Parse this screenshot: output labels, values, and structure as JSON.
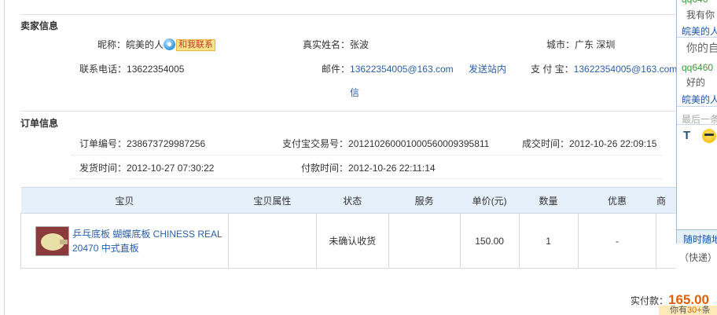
{
  "seller": {
    "section_title": "卖家信息",
    "nickname_label": "昵称：",
    "nickname": "皖美的人",
    "contact_label": "和我联系",
    "realname_label": "真实姓名：",
    "realname": "张波",
    "city_label": "城市：",
    "city": "广东 深圳",
    "phone_label": "联系电话：",
    "phone": "13622354005",
    "email_label": "邮件：",
    "email": "13622354005@163.com",
    "send_msg_line1": "发送站内",
    "send_msg_line2": "信",
    "alipay_label": "支 付 宝：",
    "alipay": "13622354005@163.com"
  },
  "order": {
    "section_title": "订单信息",
    "order_no_label": "订单编号：",
    "order_no": "238673729987256",
    "alipay_trade_label": "支付宝交易号：",
    "alipay_trade_no": "2012102600010005600093958 11",
    "deal_time_label": "成交时间：",
    "deal_time": "2012-10-26 22:09:15",
    "ship_time_label": "发货时间：",
    "ship_time": "2012-10-27 07:30:22",
    "pay_time_label": "付款时间：",
    "pay_time": "2012-10-26 22:11:14"
  },
  "table": {
    "headers": [
      "宝贝",
      "宝贝属性",
      "状态",
      "服务",
      "单价(元)",
      "数量",
      "优惠",
      "商"
    ],
    "rows": [
      {
        "item_title_line1": "乒乓底板 蝴蝶底板 CHINESS REAL",
        "item_title_line2": "20470 中式直板",
        "attributes": "",
        "status": "未确认收货",
        "service": "",
        "price": "150.00",
        "qty": "1",
        "discount": "-",
        "extra": "（快递）"
      }
    ]
  },
  "payment": {
    "actual_label": "实付款：",
    "actual_amount": "165.00",
    "badge_prefix": "你有",
    "badge_highlight": "30+",
    "badge_suffix": "条"
  },
  "chat": {
    "line1": "qq646",
    "line2": "我有你",
    "line3": "皖美的人",
    "line4": "你的自",
    "line5": "qq6460",
    "line6": "好的",
    "line7": "皖美的人",
    "line8": "最后一条",
    "footer": "随时随地"
  }
}
